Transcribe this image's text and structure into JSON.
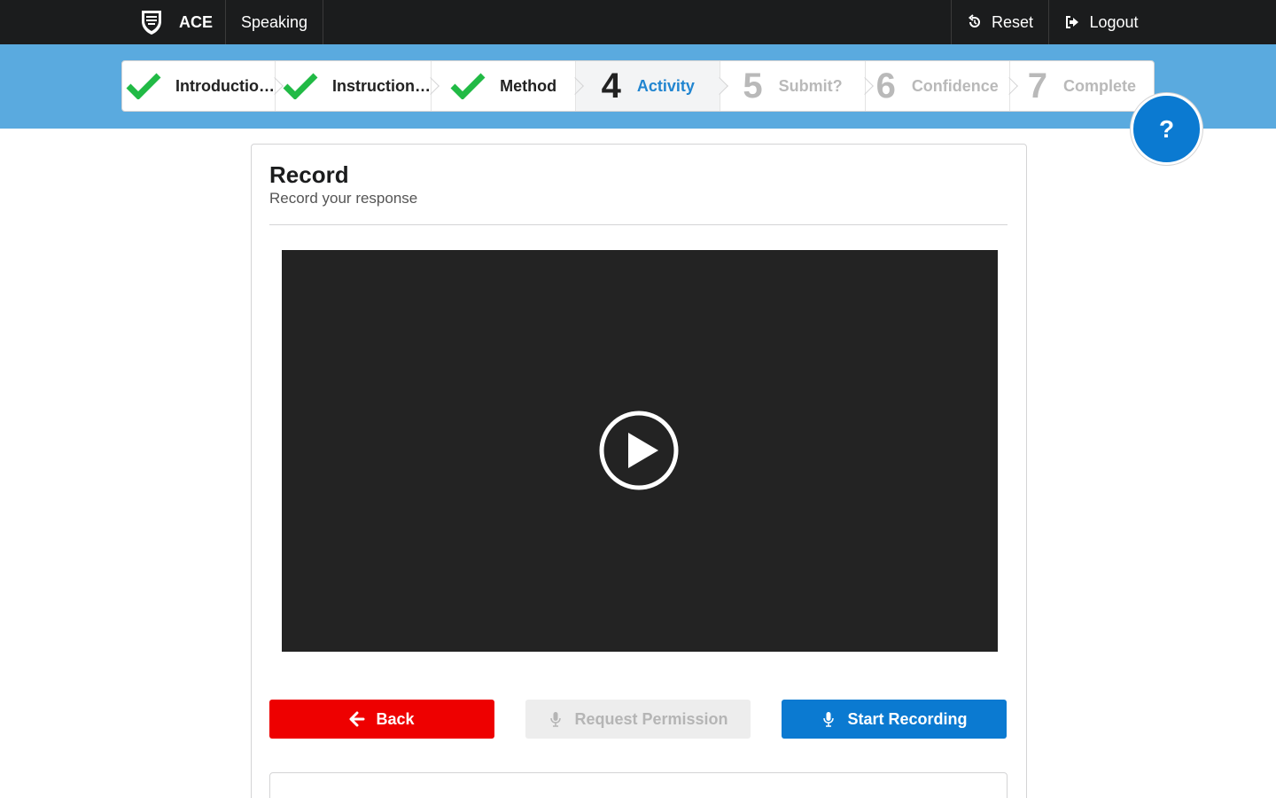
{
  "header": {
    "brand": "ACE",
    "section": "Speaking",
    "reset_label": "Reset",
    "logout_label": "Logout",
    "icons": {
      "logo": "crest-logo-icon",
      "reset": "undo-icon",
      "logout": "sign-out-icon"
    }
  },
  "steps": [
    {
      "label": "Introductio…",
      "state": "completed",
      "icon": "checkmark-icon"
    },
    {
      "label": "Instruction…",
      "state": "completed",
      "icon": "checkmark-icon"
    },
    {
      "label": "Method",
      "state": "completed",
      "icon": "checkmark-icon"
    },
    {
      "number": "4",
      "label": "Activity",
      "state": "active"
    },
    {
      "number": "5",
      "label": "Submit?",
      "state": "disabled"
    },
    {
      "number": "6",
      "label": "Confidence",
      "state": "disabled"
    },
    {
      "number": "7",
      "label": "Complete",
      "state": "disabled"
    }
  ],
  "help": {
    "label": "?"
  },
  "card": {
    "title": "Record",
    "subtitle": "Record your response"
  },
  "video": {
    "state": "paused",
    "icon": "play-circle-icon"
  },
  "buttons": {
    "back": "Back",
    "request_permission": "Request Permission",
    "start_recording": "Start Recording"
  },
  "colors": {
    "topbar": "#1b1c1d",
    "band": "#5aaadf",
    "accent": "#2185d0",
    "primary_button": "#0b7ad1",
    "back_button": "#ee0000",
    "check": "#21ba45",
    "video_bg": "#232323"
  }
}
